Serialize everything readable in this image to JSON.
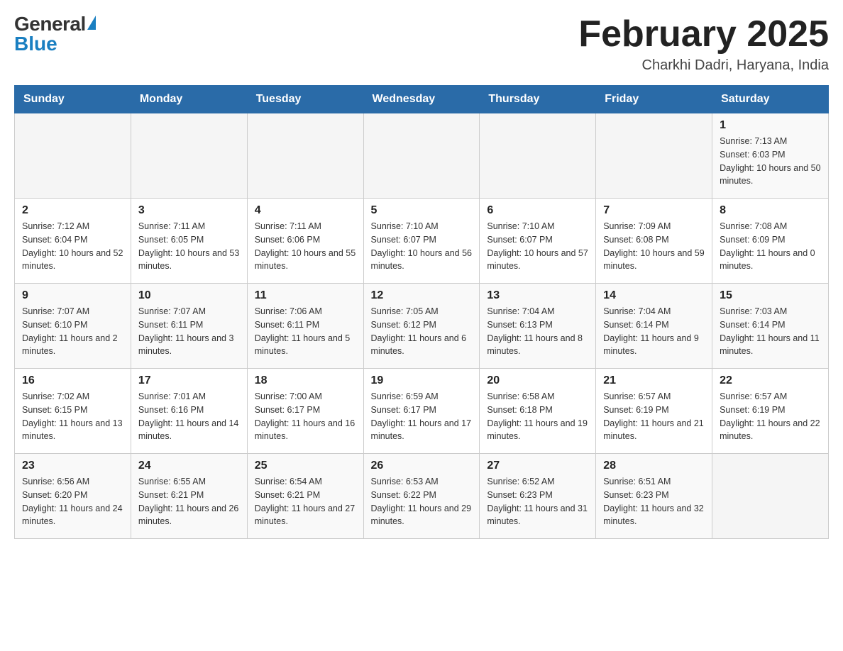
{
  "header": {
    "logo_general": "General",
    "logo_blue": "Blue",
    "title": "February 2025",
    "subtitle": "Charkhi Dadri, Haryana, India"
  },
  "weekdays": [
    "Sunday",
    "Monday",
    "Tuesday",
    "Wednesday",
    "Thursday",
    "Friday",
    "Saturday"
  ],
  "rows": [
    {
      "days": [
        {
          "empty": true
        },
        {
          "empty": true
        },
        {
          "empty": true
        },
        {
          "empty": true
        },
        {
          "empty": true
        },
        {
          "empty": true
        },
        {
          "number": "1",
          "sunrise": "Sunrise: 7:13 AM",
          "sunset": "Sunset: 6:03 PM",
          "daylight": "Daylight: 10 hours and 50 minutes."
        }
      ]
    },
    {
      "days": [
        {
          "number": "2",
          "sunrise": "Sunrise: 7:12 AM",
          "sunset": "Sunset: 6:04 PM",
          "daylight": "Daylight: 10 hours and 52 minutes."
        },
        {
          "number": "3",
          "sunrise": "Sunrise: 7:11 AM",
          "sunset": "Sunset: 6:05 PM",
          "daylight": "Daylight: 10 hours and 53 minutes."
        },
        {
          "number": "4",
          "sunrise": "Sunrise: 7:11 AM",
          "sunset": "Sunset: 6:06 PM",
          "daylight": "Daylight: 10 hours and 55 minutes."
        },
        {
          "number": "5",
          "sunrise": "Sunrise: 7:10 AM",
          "sunset": "Sunset: 6:07 PM",
          "daylight": "Daylight: 10 hours and 56 minutes."
        },
        {
          "number": "6",
          "sunrise": "Sunrise: 7:10 AM",
          "sunset": "Sunset: 6:07 PM",
          "daylight": "Daylight: 10 hours and 57 minutes."
        },
        {
          "number": "7",
          "sunrise": "Sunrise: 7:09 AM",
          "sunset": "Sunset: 6:08 PM",
          "daylight": "Daylight: 10 hours and 59 minutes."
        },
        {
          "number": "8",
          "sunrise": "Sunrise: 7:08 AM",
          "sunset": "Sunset: 6:09 PM",
          "daylight": "Daylight: 11 hours and 0 minutes."
        }
      ]
    },
    {
      "days": [
        {
          "number": "9",
          "sunrise": "Sunrise: 7:07 AM",
          "sunset": "Sunset: 6:10 PM",
          "daylight": "Daylight: 11 hours and 2 minutes."
        },
        {
          "number": "10",
          "sunrise": "Sunrise: 7:07 AM",
          "sunset": "Sunset: 6:11 PM",
          "daylight": "Daylight: 11 hours and 3 minutes."
        },
        {
          "number": "11",
          "sunrise": "Sunrise: 7:06 AM",
          "sunset": "Sunset: 6:11 PM",
          "daylight": "Daylight: 11 hours and 5 minutes."
        },
        {
          "number": "12",
          "sunrise": "Sunrise: 7:05 AM",
          "sunset": "Sunset: 6:12 PM",
          "daylight": "Daylight: 11 hours and 6 minutes."
        },
        {
          "number": "13",
          "sunrise": "Sunrise: 7:04 AM",
          "sunset": "Sunset: 6:13 PM",
          "daylight": "Daylight: 11 hours and 8 minutes."
        },
        {
          "number": "14",
          "sunrise": "Sunrise: 7:04 AM",
          "sunset": "Sunset: 6:14 PM",
          "daylight": "Daylight: 11 hours and 9 minutes."
        },
        {
          "number": "15",
          "sunrise": "Sunrise: 7:03 AM",
          "sunset": "Sunset: 6:14 PM",
          "daylight": "Daylight: 11 hours and 11 minutes."
        }
      ]
    },
    {
      "days": [
        {
          "number": "16",
          "sunrise": "Sunrise: 7:02 AM",
          "sunset": "Sunset: 6:15 PM",
          "daylight": "Daylight: 11 hours and 13 minutes."
        },
        {
          "number": "17",
          "sunrise": "Sunrise: 7:01 AM",
          "sunset": "Sunset: 6:16 PM",
          "daylight": "Daylight: 11 hours and 14 minutes."
        },
        {
          "number": "18",
          "sunrise": "Sunrise: 7:00 AM",
          "sunset": "Sunset: 6:17 PM",
          "daylight": "Daylight: 11 hours and 16 minutes."
        },
        {
          "number": "19",
          "sunrise": "Sunrise: 6:59 AM",
          "sunset": "Sunset: 6:17 PM",
          "daylight": "Daylight: 11 hours and 17 minutes."
        },
        {
          "number": "20",
          "sunrise": "Sunrise: 6:58 AM",
          "sunset": "Sunset: 6:18 PM",
          "daylight": "Daylight: 11 hours and 19 minutes."
        },
        {
          "number": "21",
          "sunrise": "Sunrise: 6:57 AM",
          "sunset": "Sunset: 6:19 PM",
          "daylight": "Daylight: 11 hours and 21 minutes."
        },
        {
          "number": "22",
          "sunrise": "Sunrise: 6:57 AM",
          "sunset": "Sunset: 6:19 PM",
          "daylight": "Daylight: 11 hours and 22 minutes."
        }
      ]
    },
    {
      "days": [
        {
          "number": "23",
          "sunrise": "Sunrise: 6:56 AM",
          "sunset": "Sunset: 6:20 PM",
          "daylight": "Daylight: 11 hours and 24 minutes."
        },
        {
          "number": "24",
          "sunrise": "Sunrise: 6:55 AM",
          "sunset": "Sunset: 6:21 PM",
          "daylight": "Daylight: 11 hours and 26 minutes."
        },
        {
          "number": "25",
          "sunrise": "Sunrise: 6:54 AM",
          "sunset": "Sunset: 6:21 PM",
          "daylight": "Daylight: 11 hours and 27 minutes."
        },
        {
          "number": "26",
          "sunrise": "Sunrise: 6:53 AM",
          "sunset": "Sunset: 6:22 PM",
          "daylight": "Daylight: 11 hours and 29 minutes."
        },
        {
          "number": "27",
          "sunrise": "Sunrise: 6:52 AM",
          "sunset": "Sunset: 6:23 PM",
          "daylight": "Daylight: 11 hours and 31 minutes."
        },
        {
          "number": "28",
          "sunrise": "Sunrise: 6:51 AM",
          "sunset": "Sunset: 6:23 PM",
          "daylight": "Daylight: 11 hours and 32 minutes."
        },
        {
          "empty": true
        }
      ]
    }
  ]
}
